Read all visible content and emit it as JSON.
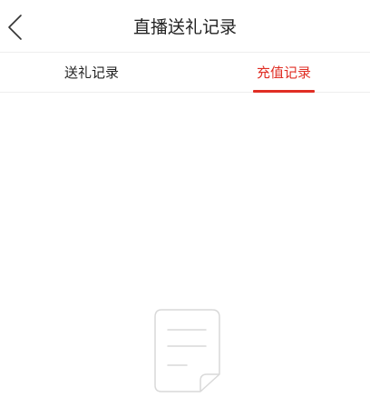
{
  "header": {
    "title": "直播送礼记录",
    "back_icon": "chevron-left-icon"
  },
  "tabs": [
    {
      "label": "送礼记录",
      "active": false
    },
    {
      "label": "充值记录",
      "active": true
    }
  ],
  "colors": {
    "accent": "#e02e24",
    "divider": "#eeeeee",
    "icon_stroke": "#d9d9d9"
  },
  "empty_state": {
    "icon": "empty-document-icon"
  }
}
